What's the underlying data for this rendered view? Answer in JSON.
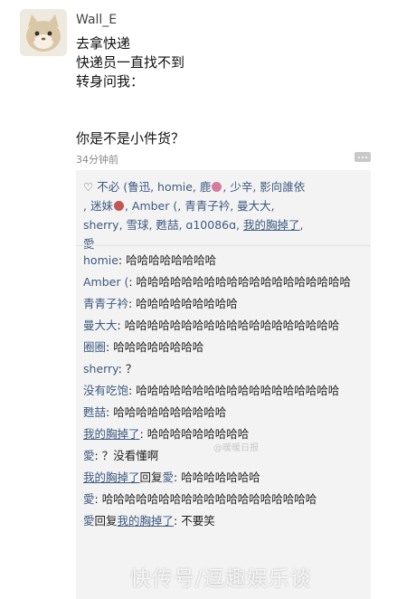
{
  "post": {
    "username": "Wall_E",
    "lines": [
      "去拿快递",
      "快递员一直找不到",
      "转身问我："
    ],
    "question": "你是不是小件货？",
    "time": "34分钟前"
  },
  "likes": {
    "p1": "不必 (鲁迅, homie, 鹿",
    "p2": ", 少辛, 影向誰依",
    "p3": ", 迷妹",
    "p4": ", Amber (, 青青子衿, 曼大大,",
    "p5": "sherry, 雪球, 甦喆, ɑ10086ɑ,",
    "p6": "我的胸掉了",
    "p7": ",",
    "p8": "愛"
  },
  "comments": [
    {
      "name": "homie",
      "text": ": 哈哈哈哈哈哈哈哈"
    },
    {
      "name": "Amber (",
      "text": ": 哈哈哈哈哈哈哈哈哈哈哈哈哈哈哈哈哈哈哈"
    },
    {
      "name": "青青子衿",
      "text": ": 哈哈哈哈哈哈哈哈哈"
    },
    {
      "name": "曼大大",
      "text": ": 哈哈哈哈哈哈哈哈哈哈哈哈哈哈哈哈哈哈哈"
    },
    {
      "name": "圈圈",
      "text": ": 哈哈哈哈哈哈哈哈"
    },
    {
      "name": "sherry",
      "text": ": ？"
    },
    {
      "name": "没有吃饱",
      "text": ": 哈哈哈哈哈哈哈哈哈哈哈哈哈哈哈哈哈哈"
    },
    {
      "name": "甦喆",
      "text": ": 哈哈哈哈哈哈哈哈哈哈"
    },
    {
      "name": "我的胸掉了",
      "text": ": 哈哈哈哈哈哈哈哈哈",
      "underline": true
    },
    {
      "name": "愛",
      "text": ": ？没看懂啊"
    },
    {
      "name": "我的胸掉了",
      "mid": "回复",
      "name2": "愛",
      "text": ": 哈哈哈哈哈哈哈",
      "underline": true
    },
    {
      "name": "愛",
      "text": ": 哈哈哈哈哈哈哈哈哈哈哈哈哈哈哈哈哈哈哈"
    },
    {
      "name": "愛",
      "mid": "回复",
      "name2": "我的胸掉了",
      "text": ": 不要笑",
      "underline2": true
    }
  ],
  "watermark": "快传号/逗趣娱乐谈",
  "watermark_faint": "@暖暖日报"
}
